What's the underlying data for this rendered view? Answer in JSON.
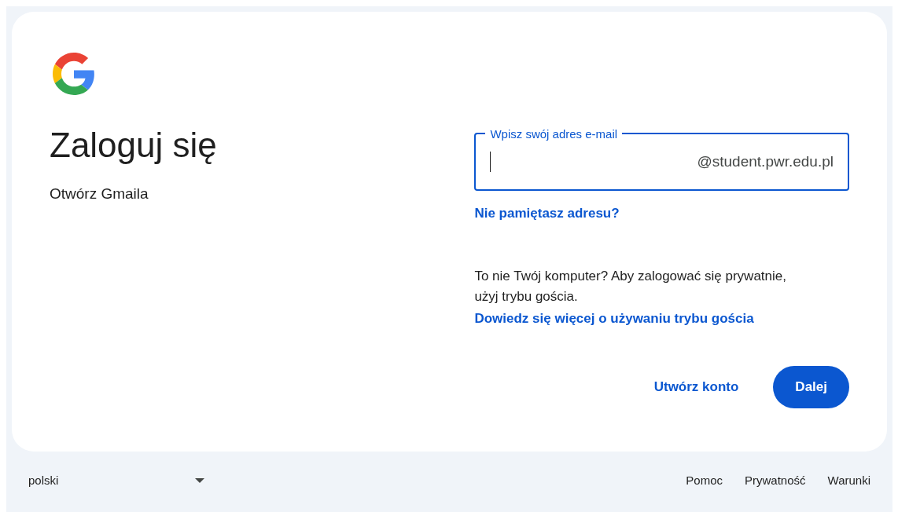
{
  "heading": {
    "title": "Zaloguj się",
    "subtitle": "Otwórz Gmaila"
  },
  "email_field": {
    "label": "Wpisz swój adres e-mail",
    "suffix": "@student.pwr.edu.pl",
    "focused": true
  },
  "forgot_link": "Nie pamiętasz adresu?",
  "guest_note": {
    "text": "To nie Twój komputer? Aby zalogować się prywatnie, użyj trybu gościa.",
    "link": "Dowiedz się więcej o używaniu trybu gościa"
  },
  "buttons": [
    {
      "kind": "text",
      "label": "Utwórz konto"
    },
    {
      "kind": "filled",
      "label": "Dalej"
    }
  ],
  "footer": {
    "language": "polski",
    "links": [
      "Pomoc",
      "Prywatność",
      "Warunki"
    ]
  }
}
